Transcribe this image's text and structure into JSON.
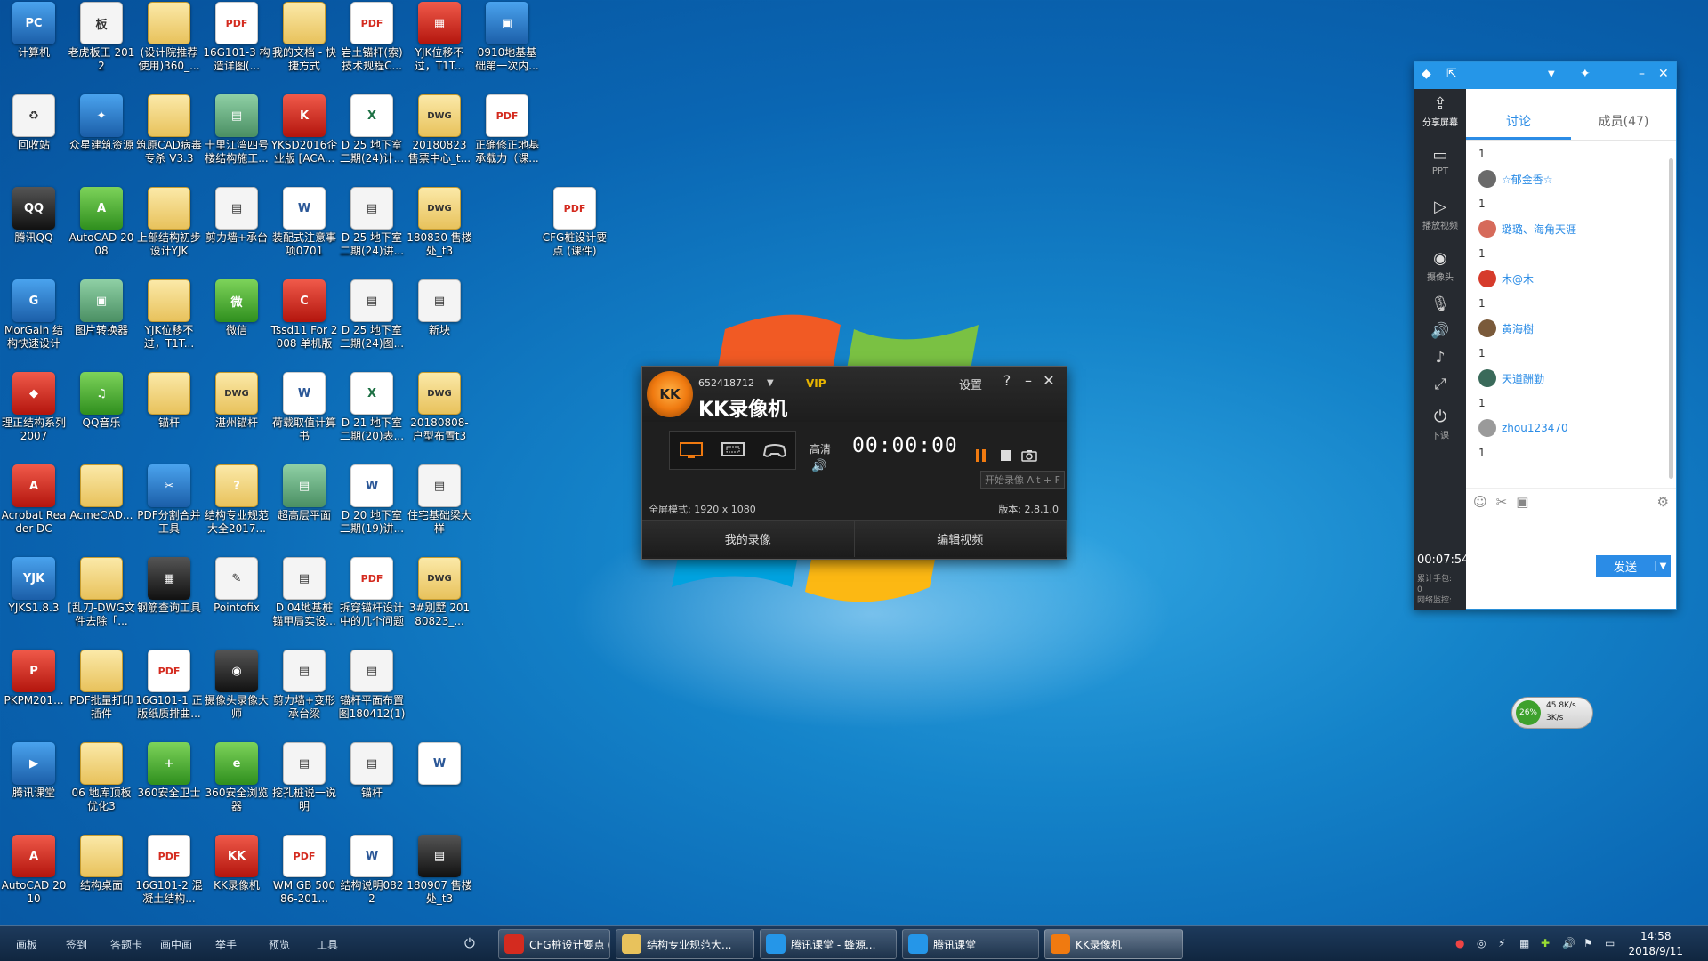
{
  "desktop_icons": [
    {
      "label": "计算机",
      "glyph": "PC",
      "style": "g-app"
    },
    {
      "label": "回收站",
      "glyph": "♻",
      "style": "g-white"
    },
    {
      "label": "腾讯QQ",
      "glyph": "QQ",
      "style": "g-dark"
    },
    {
      "label": "MorGain 结构快速设计",
      "glyph": "G",
      "style": "g-app"
    },
    {
      "label": "理正结构系列2007",
      "glyph": "◆",
      "style": "g-red"
    },
    {
      "label": "Acrobat Reader DC",
      "glyph": "A",
      "style": "g-red"
    },
    {
      "label": "YJKS1.8.3",
      "glyph": "YJK",
      "style": "g-app"
    },
    {
      "label": "PKPM201...",
      "glyph": "P",
      "style": "g-red"
    },
    {
      "label": "腾讯课堂",
      "glyph": "▶",
      "style": "g-app"
    },
    {
      "label": "AutoCAD 2010",
      "glyph": "A",
      "style": "g-red"
    },
    {
      "label": "老虎板王 2012",
      "glyph": "板",
      "style": "g-white"
    },
    {
      "label": "众星建筑资源",
      "glyph": "✦",
      "style": "g-app"
    },
    {
      "label": "AutoCAD 2008",
      "glyph": "A",
      "style": "g-green"
    },
    {
      "label": "图片转换器",
      "glyph": "▣",
      "style": "g-img"
    },
    {
      "label": "QQ音乐",
      "glyph": "♫",
      "style": "g-green"
    },
    {
      "label": "AcmeCAD...",
      "glyph": "",
      "style": "g-folder"
    },
    {
      "label": "[乱刀-DWG文件去除「...",
      "glyph": "",
      "style": "g-folder"
    },
    {
      "label": "PDF批量打印插件",
      "glyph": "",
      "style": "g-folder"
    },
    {
      "label": "06 地库顶板优化3",
      "glyph": "",
      "style": "g-folder"
    },
    {
      "label": "结构桌面",
      "glyph": "",
      "style": "g-folder"
    },
    {
      "label": "(设计院推荐使用)360_...",
      "glyph": "",
      "style": "g-folder"
    },
    {
      "label": "筑原CAD病毒专杀 V3.3",
      "glyph": "",
      "style": "g-folder"
    },
    {
      "label": "上部结构初步设计YJK",
      "glyph": "",
      "style": "g-folder"
    },
    {
      "label": "YJK位移不过，T1T...",
      "glyph": "",
      "style": "g-folder"
    },
    {
      "label": "锚杆",
      "glyph": "",
      "style": "g-folder"
    },
    {
      "label": "PDF分割合并工具",
      "glyph": "✂",
      "style": "g-app"
    },
    {
      "label": "钢筋查询工具",
      "glyph": "▦",
      "style": "g-dark"
    },
    {
      "label": "16G101-1 正版纸质排曲...",
      "glyph": "PDF",
      "style": "g-pdf"
    },
    {
      "label": "360安全卫士",
      "glyph": "+",
      "style": "g-green"
    },
    {
      "label": "16G101-2 混凝土结构...",
      "glyph": "PDF",
      "style": "g-pdf"
    },
    {
      "label": "16G101-3 构造详图(...",
      "glyph": "PDF",
      "style": "g-pdf"
    },
    {
      "label": "十里江湾四号楼结构施工...",
      "glyph": "▤",
      "style": "g-img"
    },
    {
      "label": "剪力墙+承台",
      "glyph": "▤",
      "style": "g-white"
    },
    {
      "label": "微信",
      "glyph": "微",
      "style": "g-green"
    },
    {
      "label": "湛州锚杆",
      "glyph": "DWG",
      "style": "g-dwg"
    },
    {
      "label": "结构专业规范大全2017...",
      "glyph": "?",
      "style": "g-folder"
    },
    {
      "label": "Pointofix",
      "glyph": "✎",
      "style": "g-white"
    },
    {
      "label": "摄像头录像大师",
      "glyph": "◉",
      "style": "g-dark"
    },
    {
      "label": "360安全浏览器",
      "glyph": "e",
      "style": "g-green"
    },
    {
      "label": "KK录像机",
      "glyph": "KK",
      "style": "g-red"
    },
    {
      "label": "我的文档 - 快捷方式",
      "glyph": "",
      "style": "g-folder"
    },
    {
      "label": "YKSD2016企业版 [ACA...",
      "glyph": "K",
      "style": "g-red"
    },
    {
      "label": "装配式注意事项0701",
      "glyph": "W",
      "style": "g-doc"
    },
    {
      "label": "Tssd11 For 2008 单机版",
      "glyph": "C",
      "style": "g-red"
    },
    {
      "label": "荷载取值计算书",
      "glyph": "W",
      "style": "g-doc"
    },
    {
      "label": "超高层平面",
      "glyph": "▤",
      "style": "g-img"
    },
    {
      "label": "D 04地基桩锚甲局实设...",
      "glyph": "▤",
      "style": "g-white"
    },
    {
      "label": "剪力墙+变形承台梁",
      "glyph": "▤",
      "style": "g-white"
    },
    {
      "label": "挖孔桩说一说明",
      "glyph": "▤",
      "style": "g-white"
    },
    {
      "label": "WM GB 50086-201...",
      "glyph": "PDF",
      "style": "g-pdf"
    },
    {
      "label": "岩土锚杆(索)技术规程C...",
      "glyph": "PDF",
      "style": "g-pdf"
    },
    {
      "label": "D 25 地下室二期(24)计...",
      "glyph": "X",
      "style": "g-xls"
    },
    {
      "label": "D 25 地下室二期(24)讲...",
      "glyph": "▤",
      "style": "g-white"
    },
    {
      "label": "D 25 地下室二期(24)图...",
      "glyph": "▤",
      "style": "g-white"
    },
    {
      "label": "D 21 地下室二期(20)表...",
      "glyph": "X",
      "style": "g-xls"
    },
    {
      "label": "D 20 地下室二期(19)讲...",
      "glyph": "W",
      "style": "g-doc"
    },
    {
      "label": "拆穿锚杆设计中的几个问题",
      "glyph": "PDF",
      "style": "g-pdf"
    },
    {
      "label": "锚杆平面布置图180412(1)",
      "glyph": "▤",
      "style": "g-white"
    },
    {
      "label": "锚杆",
      "glyph": "▤",
      "style": "g-white"
    },
    {
      "label": "结构说明0822",
      "glyph": "W",
      "style": "g-doc"
    },
    {
      "label": "YJK位移不过，T1T...",
      "glyph": "▦",
      "style": "g-red"
    },
    {
      "label": "20180823 售票中心_t...",
      "glyph": "DWG",
      "style": "g-dwg"
    },
    {
      "label": "180830 售楼处_t3",
      "glyph": "DWG",
      "style": "g-dwg"
    },
    {
      "label": "新块",
      "glyph": "▤",
      "style": "g-white"
    },
    {
      "label": "20180808-户型布置t3",
      "glyph": "DWG",
      "style": "g-dwg"
    },
    {
      "label": "住宅基础梁大样",
      "glyph": "▤",
      "style": "g-white"
    },
    {
      "label": "3#别墅 20180823_...",
      "glyph": "DWG",
      "style": "g-dwg"
    },
    {
      "label": "",
      "glyph": "W",
      "style": "g-doc"
    },
    {
      "label": "180907 售楼处_t3",
      "glyph": "▤",
      "style": "g-dark"
    },
    {
      "label": "0910地基基础第一次内...",
      "glyph": "▣",
      "style": "g-app"
    },
    {
      "label": "正确修正地基承载力（课...",
      "glyph": "PDF",
      "style": "g-pdf"
    },
    {
      "label": "CFG桩设计要点 (课件)",
      "glyph": "PDF",
      "style": "g-pdf"
    }
  ],
  "recorder": {
    "account": "652418712",
    "vip": "VIP",
    "title": "KK录像机",
    "settings": "设置",
    "help": "?",
    "quality": "高清",
    "timer": "00:00:00",
    "tooltip": "开始录像 Alt + F",
    "fullscreen_mode": "全屏模式: 1920 x 1080",
    "version": "版本: 2.8.1.0",
    "my_recordings": "我的录像",
    "edit_video": "编辑视频",
    "colors": {
      "accent": "#f07a10",
      "vip": "#e8b400",
      "pause": "#f07a10"
    }
  },
  "classroom": {
    "side": {
      "share": "分享屏幕",
      "ppt": "PPT",
      "video": "播放视频",
      "camera": "摄像头",
      "end": "下课",
      "time": "00:07:54",
      "stat1": "累计手包:",
      "stat2": "0",
      "stat3": "网络监控:"
    },
    "tabs": [
      "讨论",
      "成员(47)"
    ],
    "messages": [
      {
        "type": "num",
        "text": "1"
      },
      {
        "type": "user",
        "text": "☆郁金香☆",
        "color": "#6a6a6a"
      },
      {
        "type": "num",
        "text": "1"
      },
      {
        "type": "user",
        "text": "璐璐、海角天涯",
        "color": "#d66a5a"
      },
      {
        "type": "num",
        "text": "1"
      },
      {
        "type": "user",
        "text": "木@木",
        "color": "#d63b2b"
      },
      {
        "type": "num",
        "text": "1"
      },
      {
        "type": "user",
        "text": "黄海樹",
        "color": "#7a5a3a"
      },
      {
        "type": "num",
        "text": "1"
      },
      {
        "type": "user",
        "text": "天道酬勤",
        "color": "#3a6a5a"
      },
      {
        "type": "num",
        "text": "1"
      },
      {
        "type": "user",
        "text": "zhou123470",
        "color": "#9a9a9a"
      },
      {
        "type": "num",
        "text": "1"
      }
    ],
    "send": "发送"
  },
  "net": {
    "percent": "26%",
    "up": "45.8K/s",
    "down": "3K/s"
  },
  "taskbar": {
    "quick": [
      "画板",
      "签到",
      "答题卡",
      "画中画",
      "举手",
      "预览",
      "工具"
    ],
    "windows": [
      {
        "label": "CFG桩设计要点 (...",
        "color": "#d42b1f",
        "active": false
      },
      {
        "label": "结构专业规范大...",
        "color": "#e8c25c",
        "active": false
      },
      {
        "label": "腾讯课堂 - 蜂源...",
        "color": "#2596e8",
        "active": false
      },
      {
        "label": "腾讯课堂",
        "color": "#2596e8",
        "active": false
      },
      {
        "label": "KK录像机",
        "color": "#f07a10",
        "active": true
      }
    ],
    "time": "14:58",
    "date": "2018/9/11"
  }
}
